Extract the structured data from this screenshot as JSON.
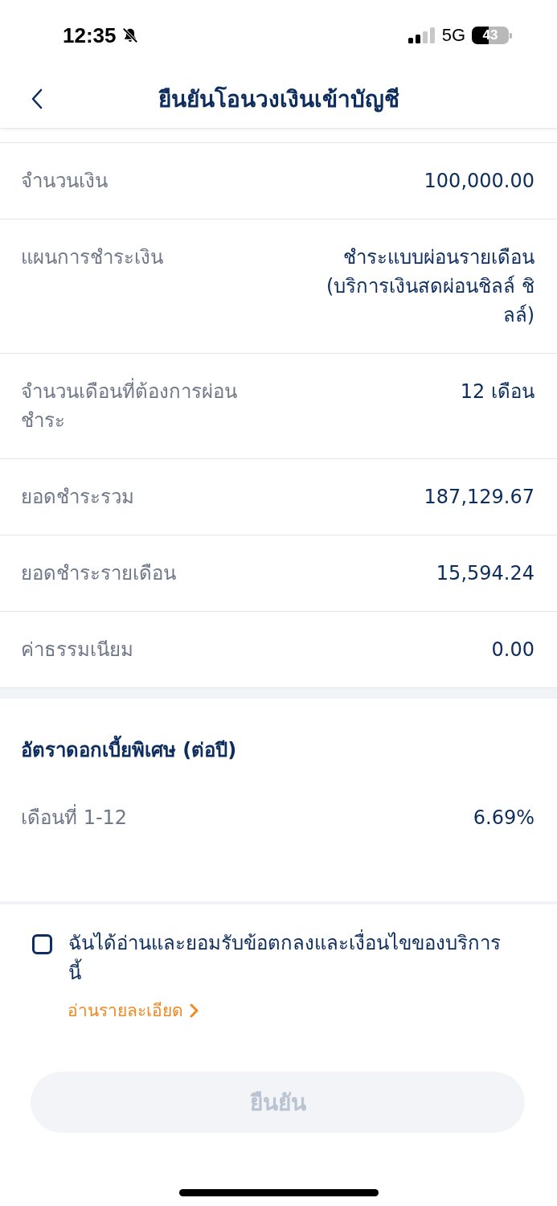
{
  "status_bar": {
    "time": "12:35",
    "network": "5G",
    "battery": "43"
  },
  "header": {
    "title": "ยืนยันโอนวงเงินเข้าบัญชี"
  },
  "details": [
    {
      "label": "จำนวนเงิน",
      "value": "100,000.00"
    },
    {
      "label": "แผนการชำระเงิน",
      "value": "ชำระแบบผ่อนรายเดือน (บริการเงินสดผ่อนชิลล์ ชิลล์)"
    },
    {
      "label": "จำนวนเดือนที่ต้องการผ่อนชำระ",
      "value": "12 เดือน"
    },
    {
      "label": "ยอดชำระรวม",
      "value": "187,129.67"
    },
    {
      "label": "ยอดชำระรายเดือน",
      "value": "15,594.24"
    },
    {
      "label": "ค่าธรรมเนียม",
      "value": "0.00"
    }
  ],
  "interest": {
    "title": "อัตราดอกเบี้ยพิเศษ (ต่อปี)",
    "rows": [
      {
        "label": "เดือนที่ 1-12",
        "value": "6.69%"
      }
    ]
  },
  "agreement": {
    "text": "ฉันได้อ่านและยอมรับข้อตกลงและเงื่อนไขของบริการนี้",
    "checked": false,
    "link": "อ่านรายละเอียด"
  },
  "confirm_button": {
    "label": "ยืนยัน",
    "disabled": true
  }
}
